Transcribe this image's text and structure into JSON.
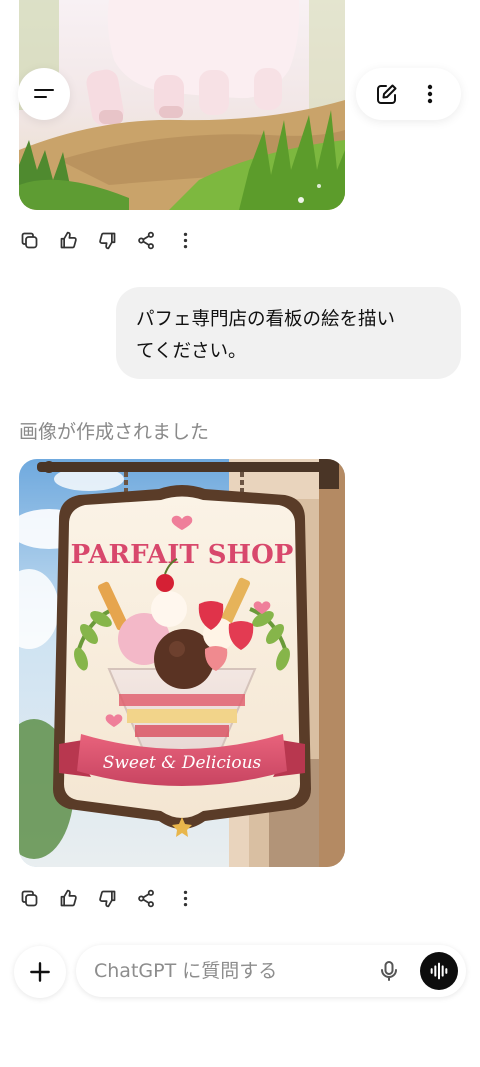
{
  "header": {
    "menu_icon": "menu-icon",
    "new_chat_icon": "edit-icon",
    "more_icon": "more-vertical-icon"
  },
  "messages": [
    {
      "role": "assistant",
      "type": "image",
      "actions": [
        "copy-icon",
        "thumbs-up-icon",
        "thumbs-down-icon",
        "share-icon",
        "more-vertical-icon"
      ]
    },
    {
      "role": "user",
      "text_line1": "パフェ専門店の看板の絵を描い",
      "text_line2": "てください。"
    },
    {
      "role": "assistant",
      "type": "image",
      "status": "画像が作成されました",
      "image_text": {
        "sign_title": "PARFAIT SHOP",
        "ribbon_text": "Sweet & Delicious"
      },
      "actions": [
        "copy-icon",
        "thumbs-up-icon",
        "thumbs-down-icon",
        "share-icon",
        "more-vertical-icon"
      ]
    }
  ],
  "composer": {
    "placeholder": "ChatGPT に質問する",
    "add_icon": "plus-icon",
    "mic_icon": "mic-icon",
    "voice_icon": "voice-mode-icon"
  },
  "colors": {
    "bubble": "#f1f1f1",
    "status_text": "#8a8a8a",
    "voice_button": "#0d0d0d"
  }
}
